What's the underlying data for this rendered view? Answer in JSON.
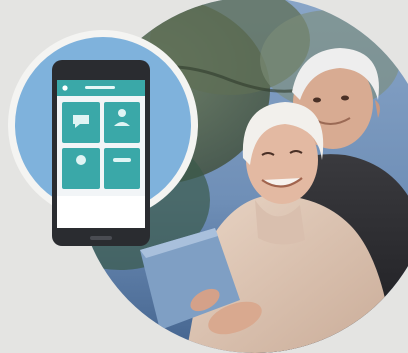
{
  "scene": {
    "background_color": "#e4e4e2",
    "photo_circle_color": "#6d8fb8",
    "badge_circle_color": "#7fb2dc",
    "badge_ring_color": "#f4f4f2",
    "phone_body_color": "#2a2c30",
    "app_header_color": "#3aa8a8",
    "app_tile_color": "#3aa8a8",
    "app_background_color": "#f2f5f7"
  },
  "phone": {
    "icon": "mobile-phone-icon",
    "tiles": [
      {
        "icon": "chat-icon"
      },
      {
        "icon": "person-icon"
      },
      {
        "icon": "alert-icon"
      },
      {
        "icon": "settings-icon"
      }
    ]
  },
  "photo": {
    "subject": "elderly-couple-with-tablet",
    "icon": "tablet-icon"
  }
}
